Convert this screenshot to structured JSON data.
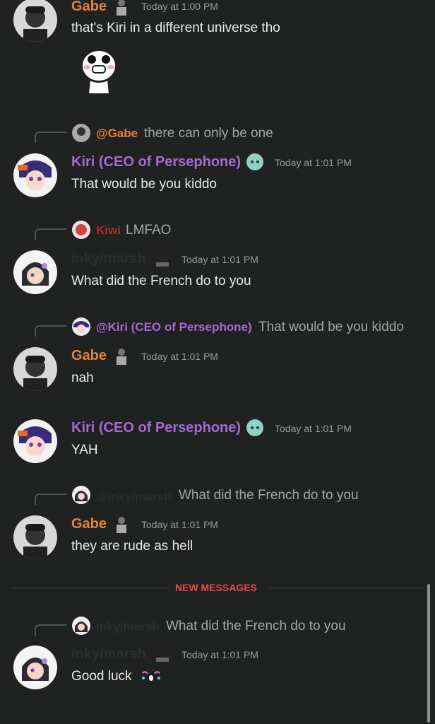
{
  "messages": [
    {
      "author": "Gabe",
      "time": "Today at 1:00 PM",
      "text": "that's Kiri in a different universe tho"
    },
    {
      "reply_to": "@Gabe",
      "reply_text": "there can only be one",
      "author": "Kiri (CEO of Persephone)",
      "time": "Today at 1:01 PM",
      "text": "That would be you kiddo"
    },
    {
      "reply_to": "Kiwi",
      "reply_text": "LMFAO",
      "author": "inky/marsh",
      "time": "Today at 1:01 PM",
      "text": "What did the French do to you"
    },
    {
      "reply_to": "@Kiri (CEO of Persephone)",
      "reply_text": "That would be you kiddo",
      "author": "Gabe",
      "time": "Today at 1:01 PM",
      "text": "nah"
    },
    {
      "author": "Kiri (CEO of Persephone)",
      "time": "Today at 1:01 PM",
      "text": "YAH"
    },
    {
      "reply_to": "@inky/marsh",
      "reply_text": "What did the French do to you",
      "author": "Gabe",
      "time": "Today at 1:01 PM",
      "text": "they are rude as hell"
    },
    {
      "reply_to": "inky/marsh",
      "reply_text": "What did the French do to you",
      "author": "inky/marsh",
      "time": "Today at 1:01 PM",
      "text": "Good luck"
    }
  ],
  "divider": {
    "label": "NEW MESSAGES"
  },
  "colors": {
    "background": "#1f2221",
    "gabe": "#e1843b",
    "kiri": "#a56ad6",
    "inky": "#2b2d30",
    "kiwi": "#b32b2b",
    "new_messages": "#f04747"
  },
  "icons": [
    "avatar-gabe",
    "avatar-kiri",
    "avatar-inky",
    "sticker-face",
    "emoji-badge",
    "crying-emoji"
  ]
}
